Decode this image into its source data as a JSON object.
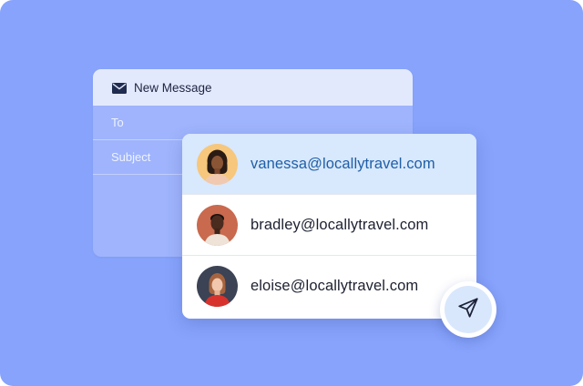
{
  "compose": {
    "title": "New Message",
    "title_icon": "envelope-icon",
    "to_label": "To",
    "subject_label": "Subject"
  },
  "contacts": [
    {
      "email": "vanessa@locallytravel.com",
      "selected": true,
      "avatar_bg": "#f6c77c"
    },
    {
      "email": "bradley@locallytravel.com",
      "selected": false,
      "avatar_bg": "#c9694e"
    },
    {
      "email": "eloise@locallytravel.com",
      "selected": false,
      "avatar_bg": "#3b4354"
    }
  ],
  "send_button": {
    "icon": "send-icon"
  },
  "colors": {
    "background": "#87a3fb",
    "selected_row": "#d8e8fd",
    "selected_text": "#1f5fa6",
    "send_circle": "#d9e7fd"
  }
}
